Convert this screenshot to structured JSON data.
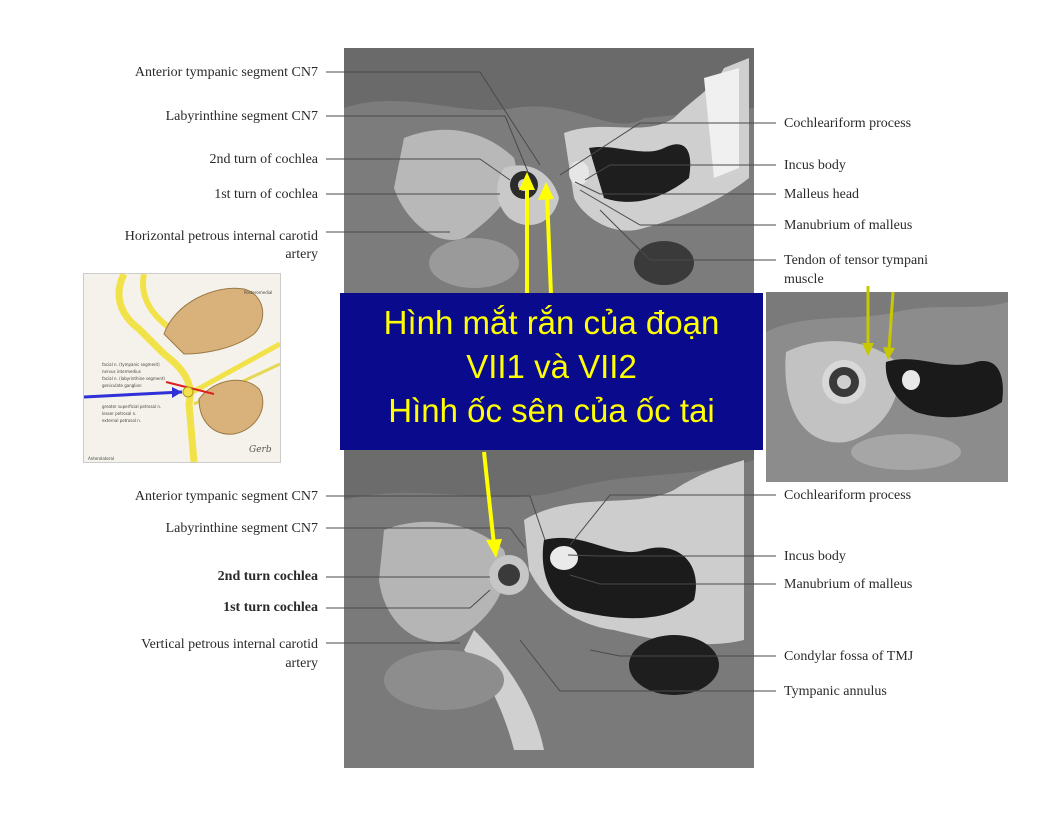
{
  "top_labels_left": [
    "Anterior tympanic segment CN7",
    "Labyrinthine segment CN7",
    "2nd turn of cochlea",
    "1st turn of cochlea",
    "Horizontal petrous internal carotid",
    "artery"
  ],
  "top_labels_right": [
    "Cochleariform process",
    "Incus body",
    "Malleus head",
    "Manubrium of malleus",
    "Tendon of tensor tympani",
    "muscle"
  ],
  "bottom_labels_left": [
    "Anterior tympanic segment CN7",
    "Labyrinthine segment CN7",
    "2nd turn cochlea",
    "1st turn cochlea",
    "Vertical petrous internal carotid",
    "artery"
  ],
  "bottom_labels_right": [
    "Cochleariform process",
    "Incus body",
    "Manubrium of malleus",
    "Condylar fossa of TMJ",
    "Tympanic annulus"
  ],
  "banner": {
    "line1": "Hình mắt rắn của đoạn",
    "line2": "VII1 và VII2",
    "line3": "Hình ốc sên của ốc tai"
  },
  "drawing_labels": [
    "facial n. (tympanic segment)",
    "nervus intermedius",
    "facial n. (labyrinthine segment)",
    "geniculate ganglion",
    "greater superficial petrosal n.",
    "lesser petrosal n.",
    "external petrosal n.",
    "Posteromedial",
    "Anterolateral"
  ],
  "colors": {
    "banner_bg": "#0a0a8c",
    "banner_text": "#ffff00",
    "arrow_yellow": "#ffff00",
    "arrow_olive": "#c8c800",
    "nerve_yellow": "#f2e24a",
    "bone_tan": "#d8b27a",
    "arrow_blue": "#3030d8",
    "line_red": "#e02020"
  }
}
